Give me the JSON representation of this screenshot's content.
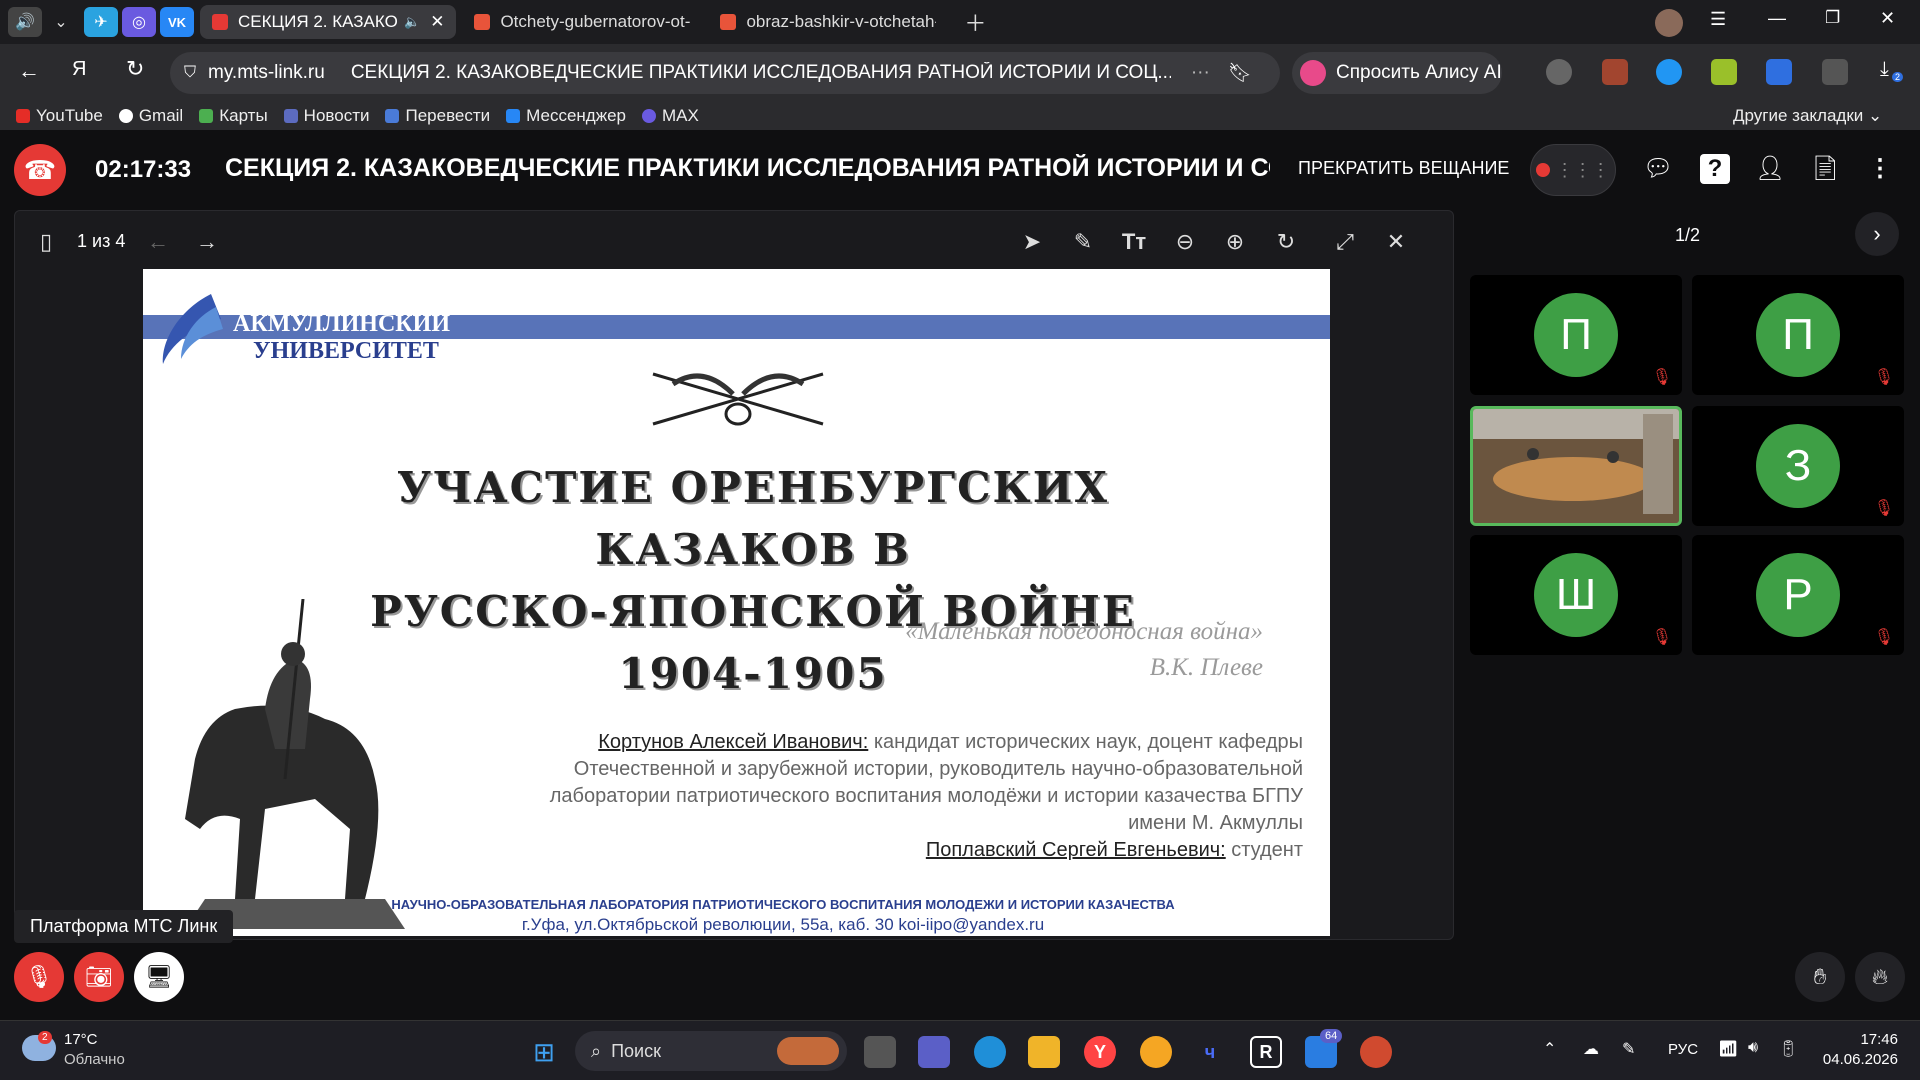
{
  "browser": {
    "tabs": [
      {
        "label": "СЕКЦИЯ 2. КАЗАКО",
        "active": true,
        "color": "#e53935"
      },
      {
        "label": "Otchety-gubernatorov-ot-",
        "active": false,
        "color": "#e8543a"
      },
      {
        "label": "obraz-bashkir-v-otchetah-",
        "active": false,
        "color": "#e8543a"
      }
    ],
    "url_domain": "my.mts-link.ru",
    "url_title": "СЕКЦИЯ 2. КАЗАКОВЕДЧЕСКИЕ ПРАКТИКИ ИССЛЕДОВАНИЯ РАТНОЙ ИСТОРИИ И СОЦ...",
    "alice_label": "Спросить Алису AI",
    "bookmarks": [
      "YouTube",
      "Gmail",
      "Карты",
      "Новости",
      "Перевести",
      "Мессенджер",
      "MAX"
    ],
    "other_bookmarks": "Другие закладки",
    "ext_badge": "2"
  },
  "meeting": {
    "timer": "02:17:33",
    "title": "СЕКЦИЯ 2. КАЗАКОВЕДЧЕСКИЕ ПРАКТИКИ ИССЛЕДОВАНИЯ РАТНОЙ ИСТОРИИ И СОЦИАЛЬНОЙ",
    "stop_broadcast": "ПРЕКРАТИТЬ ВЕЩАНИЕ",
    "viewer_pages": "1 из 4",
    "participants_page": "1/2",
    "platform_label": "Платформа МТС Линк",
    "participants": [
      {
        "initial": "П",
        "muted": true
      },
      {
        "initial": "П",
        "muted": true
      },
      {
        "initial": "",
        "video": true
      },
      {
        "initial": "З",
        "muted": true
      },
      {
        "initial": "Ш",
        "muted": true
      },
      {
        "initial": "Р",
        "muted": true
      }
    ]
  },
  "slide": {
    "university_line1": "АКМУЛЛИНСКИЙ",
    "university_line2": "УНИВЕРСИТЕТ",
    "title_line1": "УЧАСТИЕ ОРЕНБУРГСКИХ КАЗАКОВ В",
    "title_line2": "РУССКО-ЯПОНСКОЙ ВОЙНЕ 1904-1905",
    "quote": "«Маленькая победоносная война»",
    "quote_author": "В.К. Плеве",
    "author1_name": "Кортунов Алексей Иванович:",
    "author1_desc_1": " кандидат исторических наук, доцент кафедры",
    "author1_desc_2": "Отечественной и зарубежной истории, руководитель научно-образовательной",
    "author1_desc_3": "лаборатории патриотического воспитания молодёжи и истории казачества БГПУ",
    "author1_desc_4": "имени М. Акмуллы",
    "author2_name": "Поплавский Сергей Евгеньевич:",
    "author2_desc": " студент",
    "footer_lab": "НАУЧНО-ОБРАЗОВАТЕЛЬНАЯ ЛАБОРАТОРИЯ ПАТРИОТИЧЕСКОГО ВОСПИТАНИЯ МОЛОДЕЖИ И ИСТОРИИ КАЗАЧЕСТВА",
    "footer_address": "г.Уфа, ул.Октябрьской революции, 55а, каб. 30     koi-iipo@yandex.ru"
  },
  "taskbar": {
    "weather_temp": "17°C",
    "weather_desc": "Облачно",
    "weather_badge": "2",
    "search_placeholder": "Поиск",
    "app_badge": "64",
    "language": "РУС",
    "time": "17:46",
    "date": "04.06.2026"
  },
  "colors": {
    "accent_red": "#e53935",
    "avatar_green": "#3e9f45",
    "slide_blue": "#5873b8"
  }
}
